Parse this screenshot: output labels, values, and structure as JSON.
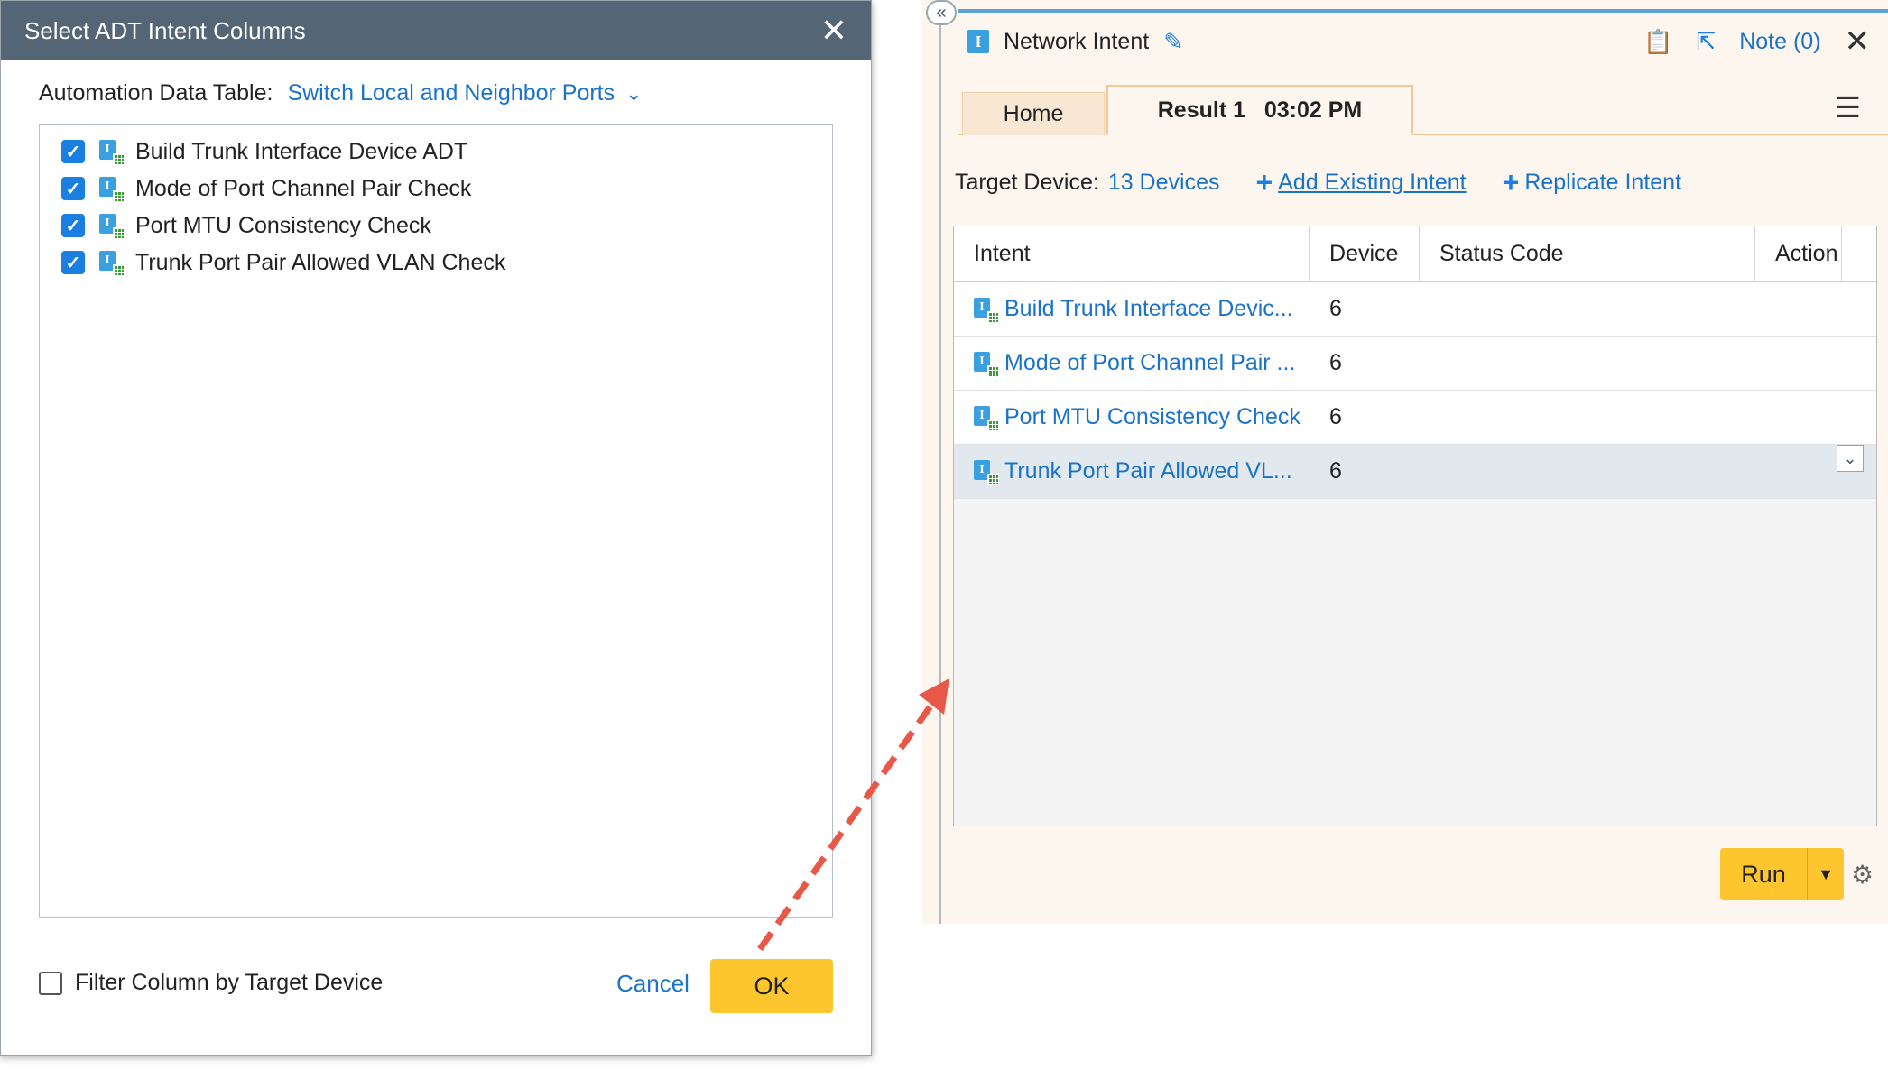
{
  "dialog": {
    "title": "Select ADT Intent Columns",
    "adt_label": "Automation Data Table:",
    "adt_value": "Switch Local and Neighbor Ports",
    "items": [
      {
        "label": "Build Trunk Interface Device ADT",
        "checked": true
      },
      {
        "label": "Mode of Port Channel Pair Check",
        "checked": true
      },
      {
        "label": "Port MTU Consistency Check",
        "checked": true
      },
      {
        "label": "Trunk Port Pair Allowed VLAN Check",
        "checked": true
      }
    ],
    "filter_label": "Filter Column by Target Device",
    "cancel_label": "Cancel",
    "ok_label": "OK"
  },
  "panel": {
    "title": "Network Intent",
    "note_label": "Note (0)",
    "tabs": [
      {
        "label": "Home"
      },
      {
        "label": "Result 1   03:02 PM"
      }
    ],
    "target_label": "Target Device:",
    "target_value": "13 Devices",
    "add_existing": "Add Existing Intent",
    "replicate": "Replicate Intent",
    "table": {
      "headers": [
        "Intent",
        "Device",
        "Status Code",
        "Action"
      ],
      "rows": [
        {
          "intent": "Build Trunk Interface Devic...",
          "device": "6"
        },
        {
          "intent": "Mode of Port Channel Pair ...",
          "device": "6"
        },
        {
          "intent": "Port MTU Consistency Check",
          "device": "6"
        },
        {
          "intent": "Trunk Port Pair Allowed VL...",
          "device": "6"
        }
      ]
    },
    "run_label": "Run"
  },
  "colors": {
    "header_bg": "#546676",
    "accent_blue": "#1a73c8",
    "button_yellow": "#fdc62e",
    "arrow_red": "#e85848",
    "panel_bg": "#fdf6ee"
  }
}
